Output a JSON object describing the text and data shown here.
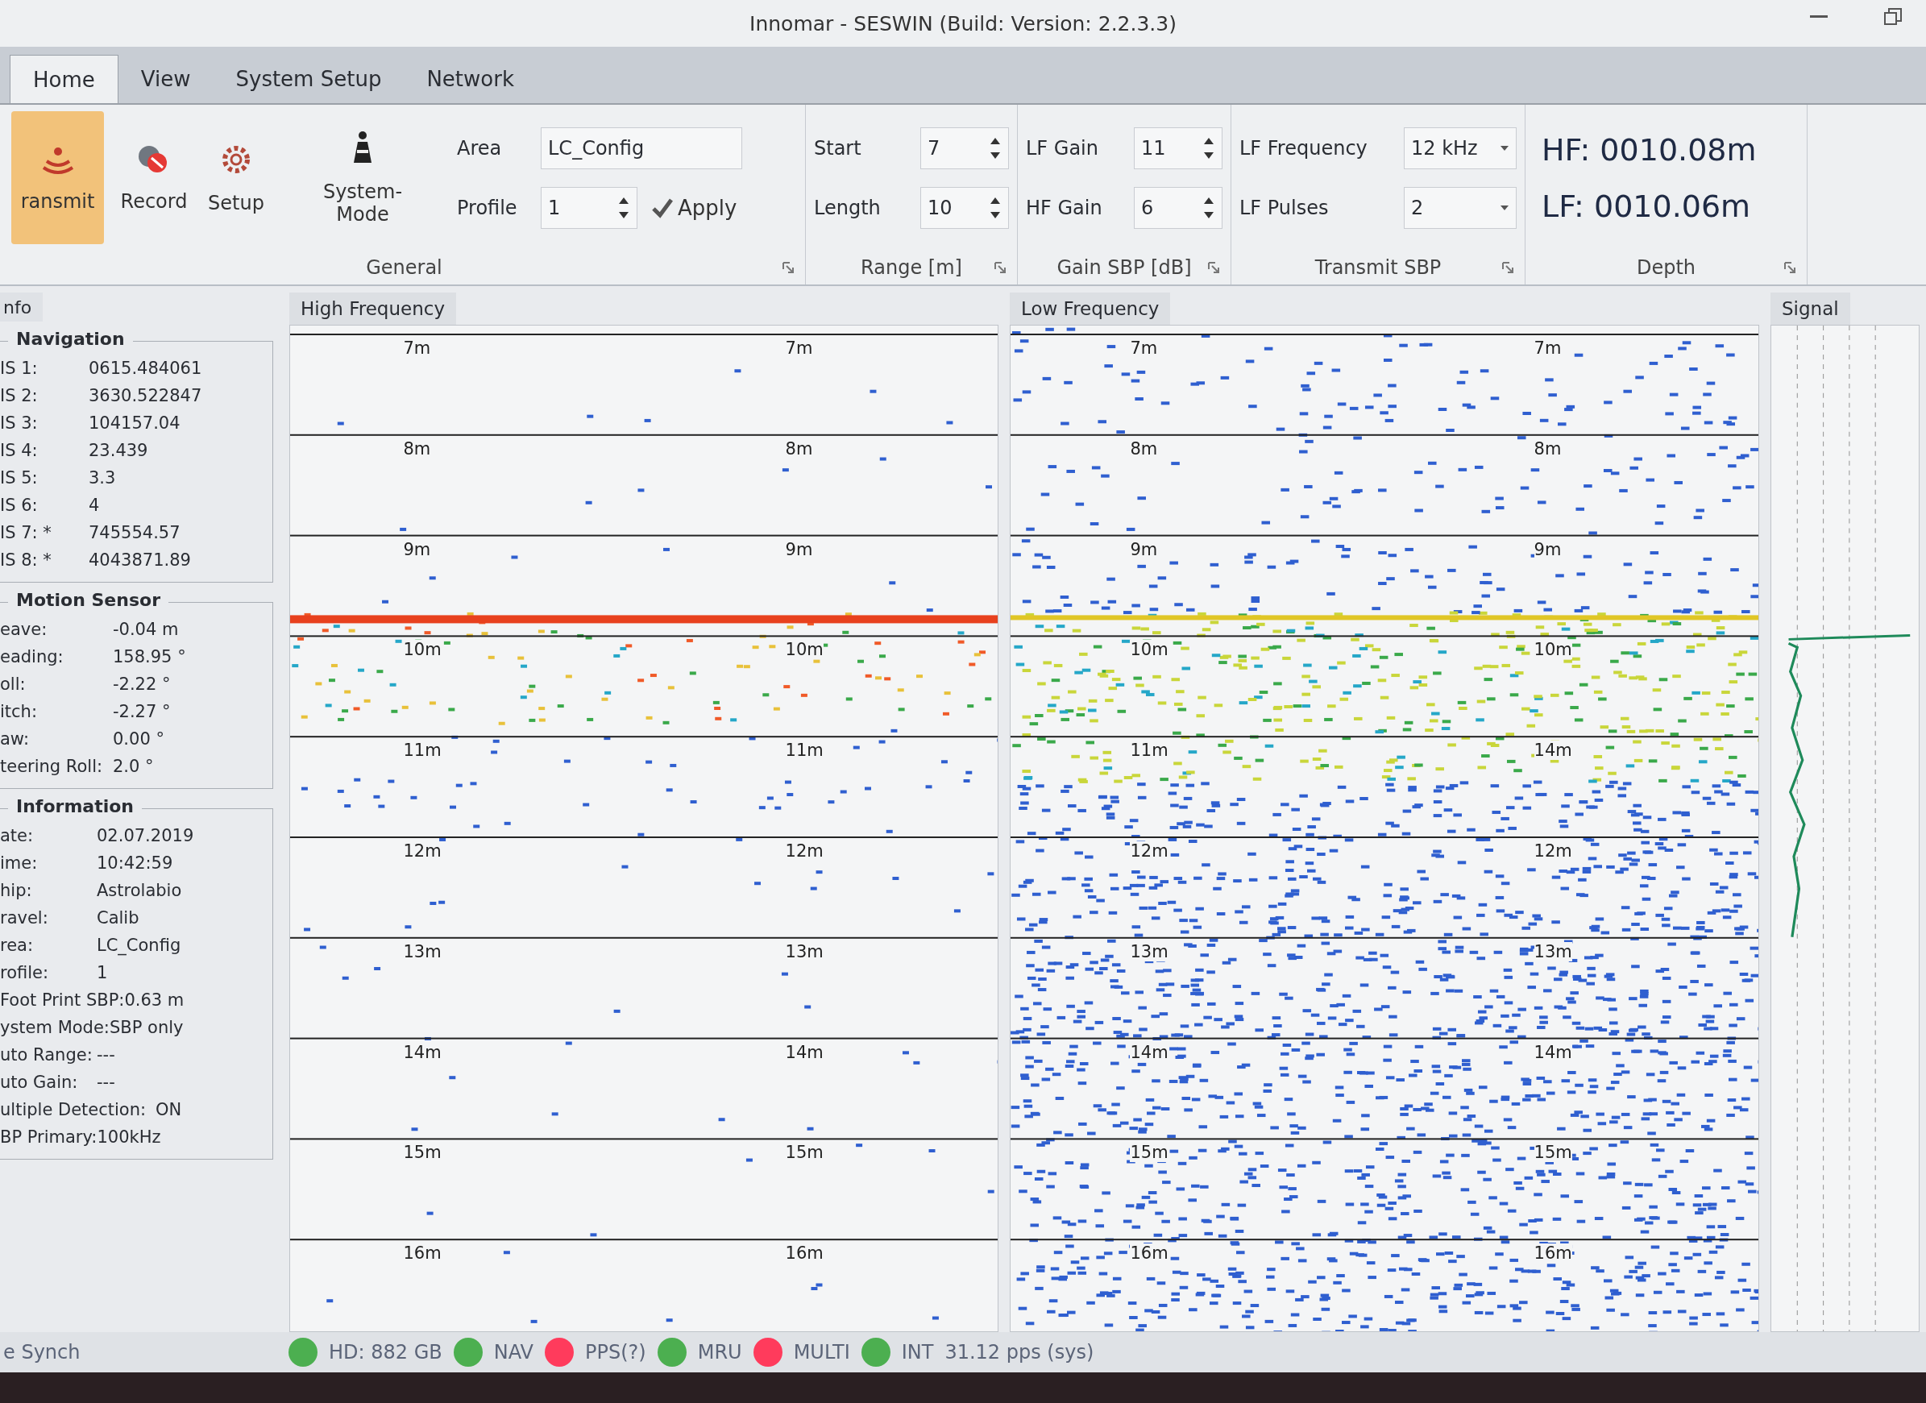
{
  "window": {
    "title": "Innomar - SESWIN (Build: Version: 2.2.3.3)"
  },
  "tabs": [
    {
      "label": "Home",
      "selected": true
    },
    {
      "label": "View",
      "selected": false
    },
    {
      "label": "System Setup",
      "selected": false
    },
    {
      "label": "Network",
      "selected": false
    }
  ],
  "ribbon": {
    "general": {
      "title": "General",
      "buttons": [
        {
          "label": "ransmit",
          "kind": "transmit",
          "active": true
        },
        {
          "label": "Record",
          "kind": "record",
          "active": false
        },
        {
          "label": "Setup",
          "kind": "setup",
          "active": false
        },
        {
          "label": "System-Mode",
          "kind": "mode",
          "active": false
        }
      ],
      "area": {
        "label": "Area",
        "value": "LC_Config"
      },
      "profile": {
        "label": "Profile",
        "value": "1"
      },
      "apply": "Apply"
    },
    "range": {
      "title": "Range [m]",
      "fields": [
        {
          "label": "Start",
          "value": "7"
        },
        {
          "label": "Length",
          "value": "10"
        }
      ]
    },
    "gain": {
      "title": "Gain SBP [dB]",
      "fields": [
        {
          "label": "LF Gain",
          "value": "11"
        },
        {
          "label": "HF Gain",
          "value": "6"
        }
      ]
    },
    "transmit": {
      "title": "Transmit SBP",
      "fields": [
        {
          "label": "LF Frequency",
          "value": "12 kHz"
        },
        {
          "label": "LF Pulses",
          "value": "2"
        }
      ]
    },
    "depth": {
      "title": "Depth",
      "readings": [
        "HF: 0010.08m",
        "LF: 0010.06m"
      ]
    }
  },
  "info": {
    "tab": "nfo",
    "sections": [
      {
        "title": "Navigation",
        "rows": [
          [
            "IS 1:",
            "0615.484061"
          ],
          [
            "IS 2:",
            "3630.522847"
          ],
          [
            "IS 3:",
            "104157.04"
          ],
          [
            "IS 4:",
            "23.439"
          ],
          [
            "IS 5:",
            "3.3"
          ],
          [
            "IS 6:",
            "4"
          ],
          [
            "IS 7: *",
            "745554.57"
          ],
          [
            "IS 8: *",
            "4043871.89"
          ]
        ]
      },
      {
        "title": "Motion Sensor",
        "rows": [
          [
            "eave:",
            "-0.04 m"
          ],
          [
            "eading:",
            "158.95 °"
          ],
          [
            "oll:",
            "-2.22 °"
          ],
          [
            "itch:",
            "-2.27 °"
          ],
          [
            "aw:",
            "0.00 °"
          ],
          [
            "teering Roll:",
            "2.0 °"
          ]
        ]
      },
      {
        "title": "Information",
        "rows": [
          [
            "ate:",
            "02.07.2019"
          ],
          [
            "ime:",
            "10:42:59"
          ],
          [
            "hip:",
            "Astrolabio"
          ],
          [
            "ravel:",
            "Calib"
          ],
          [
            "rea:",
            "LC_Config"
          ],
          [
            "rofile:",
            "1"
          ],
          [
            "Foot Print SBP:",
            "0.63 m"
          ],
          [
            "ystem Mode:",
            "SBP only"
          ],
          [
            "uto Range:",
            "---"
          ],
          [
            "uto Gain:",
            "---"
          ],
          [
            "ultiple Detection:",
            "ON"
          ],
          [
            "BP Primary:",
            "100kHz"
          ]
        ]
      }
    ]
  },
  "echograms": [
    {
      "title": "High Frequency",
      "kind": "hf",
      "depths": [
        [
          "7m",
          "7m"
        ],
        [
          "8m",
          "8m"
        ],
        [
          "9m",
          "9m"
        ],
        [
          "10m",
          "10m"
        ],
        [
          "11m",
          "11m"
        ],
        [
          "12m",
          "12m"
        ],
        [
          "13m",
          "13m"
        ],
        [
          "14m",
          "14m"
        ],
        [
          "15m",
          "15m"
        ],
        [
          "16m",
          "16m"
        ]
      ]
    },
    {
      "title": "Low Frequency",
      "kind": "lf",
      "depths": [
        [
          "7m",
          "7m"
        ],
        [
          "8m",
          "8m"
        ],
        [
          "9m",
          "9m"
        ],
        [
          "10m",
          "10m"
        ],
        [
          "11m",
          "14m"
        ],
        [
          "12m",
          "12m"
        ],
        [
          "13m",
          "13m"
        ],
        [
          "14m",
          "14m"
        ],
        [
          "15m",
          "15m"
        ],
        [
          "16m",
          "16m"
        ]
      ]
    }
  ],
  "signal": {
    "title": "Signal"
  },
  "status_bar": {
    "left": "e Synch",
    "items": [
      {
        "label": "HD: 882 GB",
        "color": "#4caf50"
      },
      {
        "label": "NAV",
        "color": "#4caf50"
      },
      {
        "label": "PPS(?)",
        "color": "#ff3b5c"
      },
      {
        "label": "MRU",
        "color": "#4caf50"
      },
      {
        "label": "MULTI",
        "color": "#ff3b5c"
      },
      {
        "label": "INT",
        "color": "#4caf50"
      }
    ],
    "rate": "31.12 pps (sys)"
  }
}
